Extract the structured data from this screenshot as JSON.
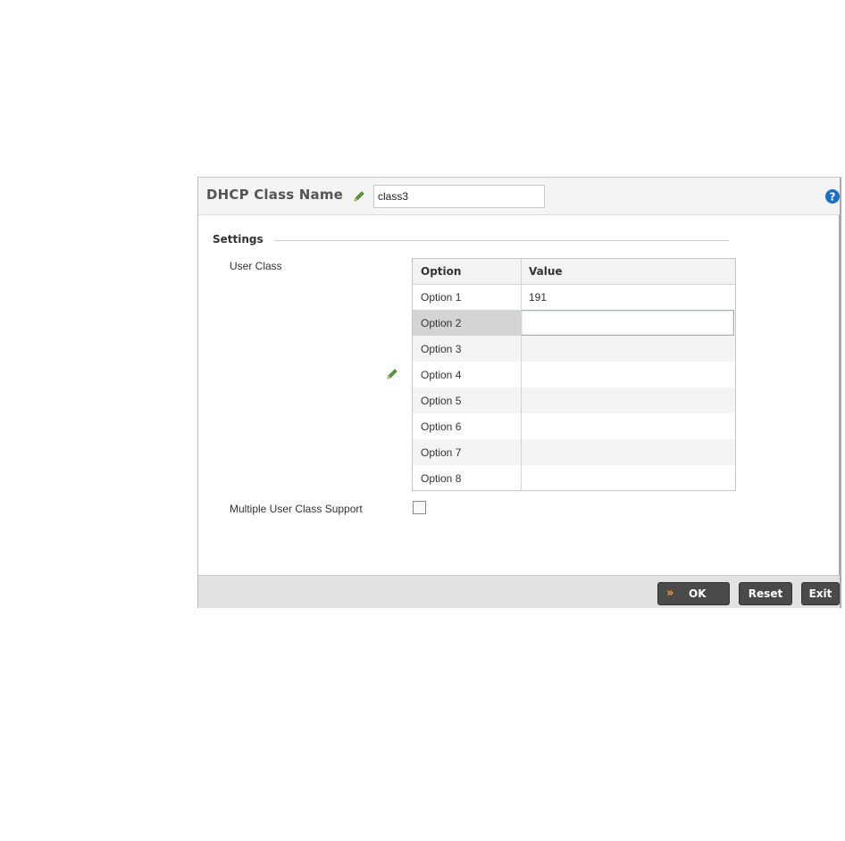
{
  "header": {
    "title": "DHCP Class Name",
    "name_value": "class3"
  },
  "settings": {
    "section_label": "Settings",
    "user_class_label": "User Class",
    "table": {
      "columns": [
        "Option",
        "Value"
      ],
      "rows": [
        {
          "option": "Option 1",
          "value": "191"
        },
        {
          "option": "Option 2",
          "value": ""
        },
        {
          "option": "Option 3",
          "value": ""
        },
        {
          "option": "Option 4",
          "value": ""
        },
        {
          "option": "Option 5",
          "value": ""
        },
        {
          "option": "Option 6",
          "value": ""
        },
        {
          "option": "Option 7",
          "value": ""
        },
        {
          "option": "Option 8",
          "value": ""
        }
      ],
      "selected_row": "Option 2"
    },
    "multiple_user_class_label": "Multiple User Class Support",
    "multiple_user_class_checked": false
  },
  "footer": {
    "ok_label": "OK",
    "reset_label": "Reset",
    "exit_label": "Exit"
  },
  "icons": {
    "edit": "pencil-icon",
    "help": "help-icon",
    "ok": "double-chevron-icon"
  },
  "colors": {
    "help_blue": "#1b6fc4",
    "ok_chevron": "#f5a623",
    "pencil_green": "#4a9a2a"
  }
}
